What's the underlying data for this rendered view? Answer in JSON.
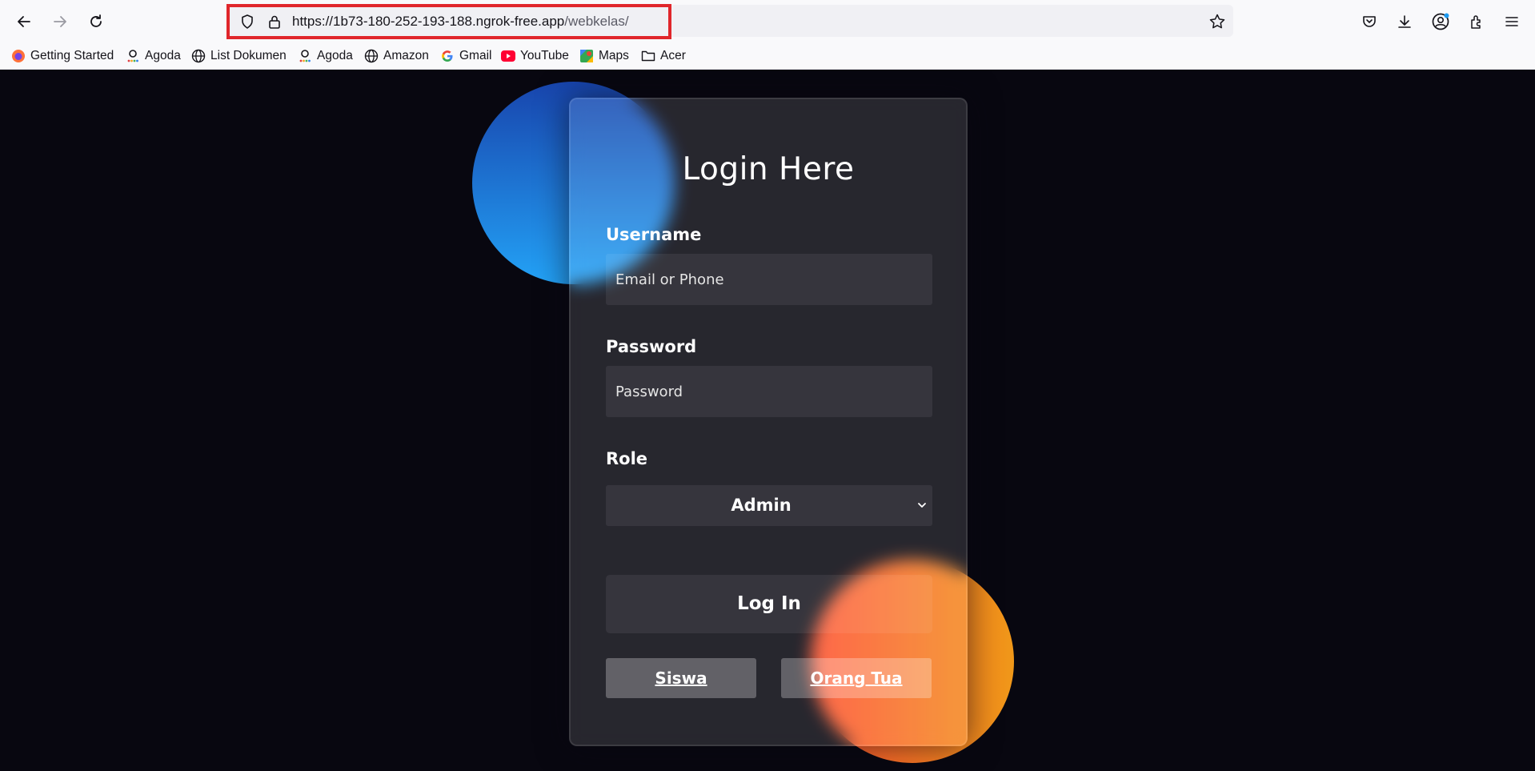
{
  "browser": {
    "url_host": "https://1b73-180-252-193-188.ngrok-free.app",
    "url_path": "/webkelas/",
    "bookmarks": [
      {
        "label": "Getting Started",
        "icon": "firefox-icon"
      },
      {
        "label": "Agoda",
        "icon": "agoda-icon"
      },
      {
        "label": "List Dokumen",
        "icon": "globe-icon"
      },
      {
        "label": "Agoda",
        "icon": "agoda-icon"
      },
      {
        "label": "Amazon",
        "icon": "globe-icon"
      },
      {
        "label": "Gmail",
        "icon": "google-icon"
      },
      {
        "label": "YouTube",
        "icon": "youtube-icon"
      },
      {
        "label": "Maps",
        "icon": "maps-icon"
      },
      {
        "label": "Acer",
        "icon": "folder-icon"
      }
    ]
  },
  "login": {
    "title": "Login Here",
    "username_label": "Username",
    "username_placeholder": "Email or Phone",
    "password_label": "Password",
    "password_placeholder": "Password",
    "role_label": "Role",
    "role_value": "Admin",
    "login_button": "Log In",
    "siswa_link": "Siswa",
    "orangtua_link": "Orang Tua"
  },
  "colors": {
    "page_background": "#080710",
    "highlight_border": "#e0262b",
    "blue_circle": [
      "#1845ad",
      "#23a2f6"
    ],
    "orange_circle": [
      "#ff512f",
      "#f09819"
    ]
  }
}
